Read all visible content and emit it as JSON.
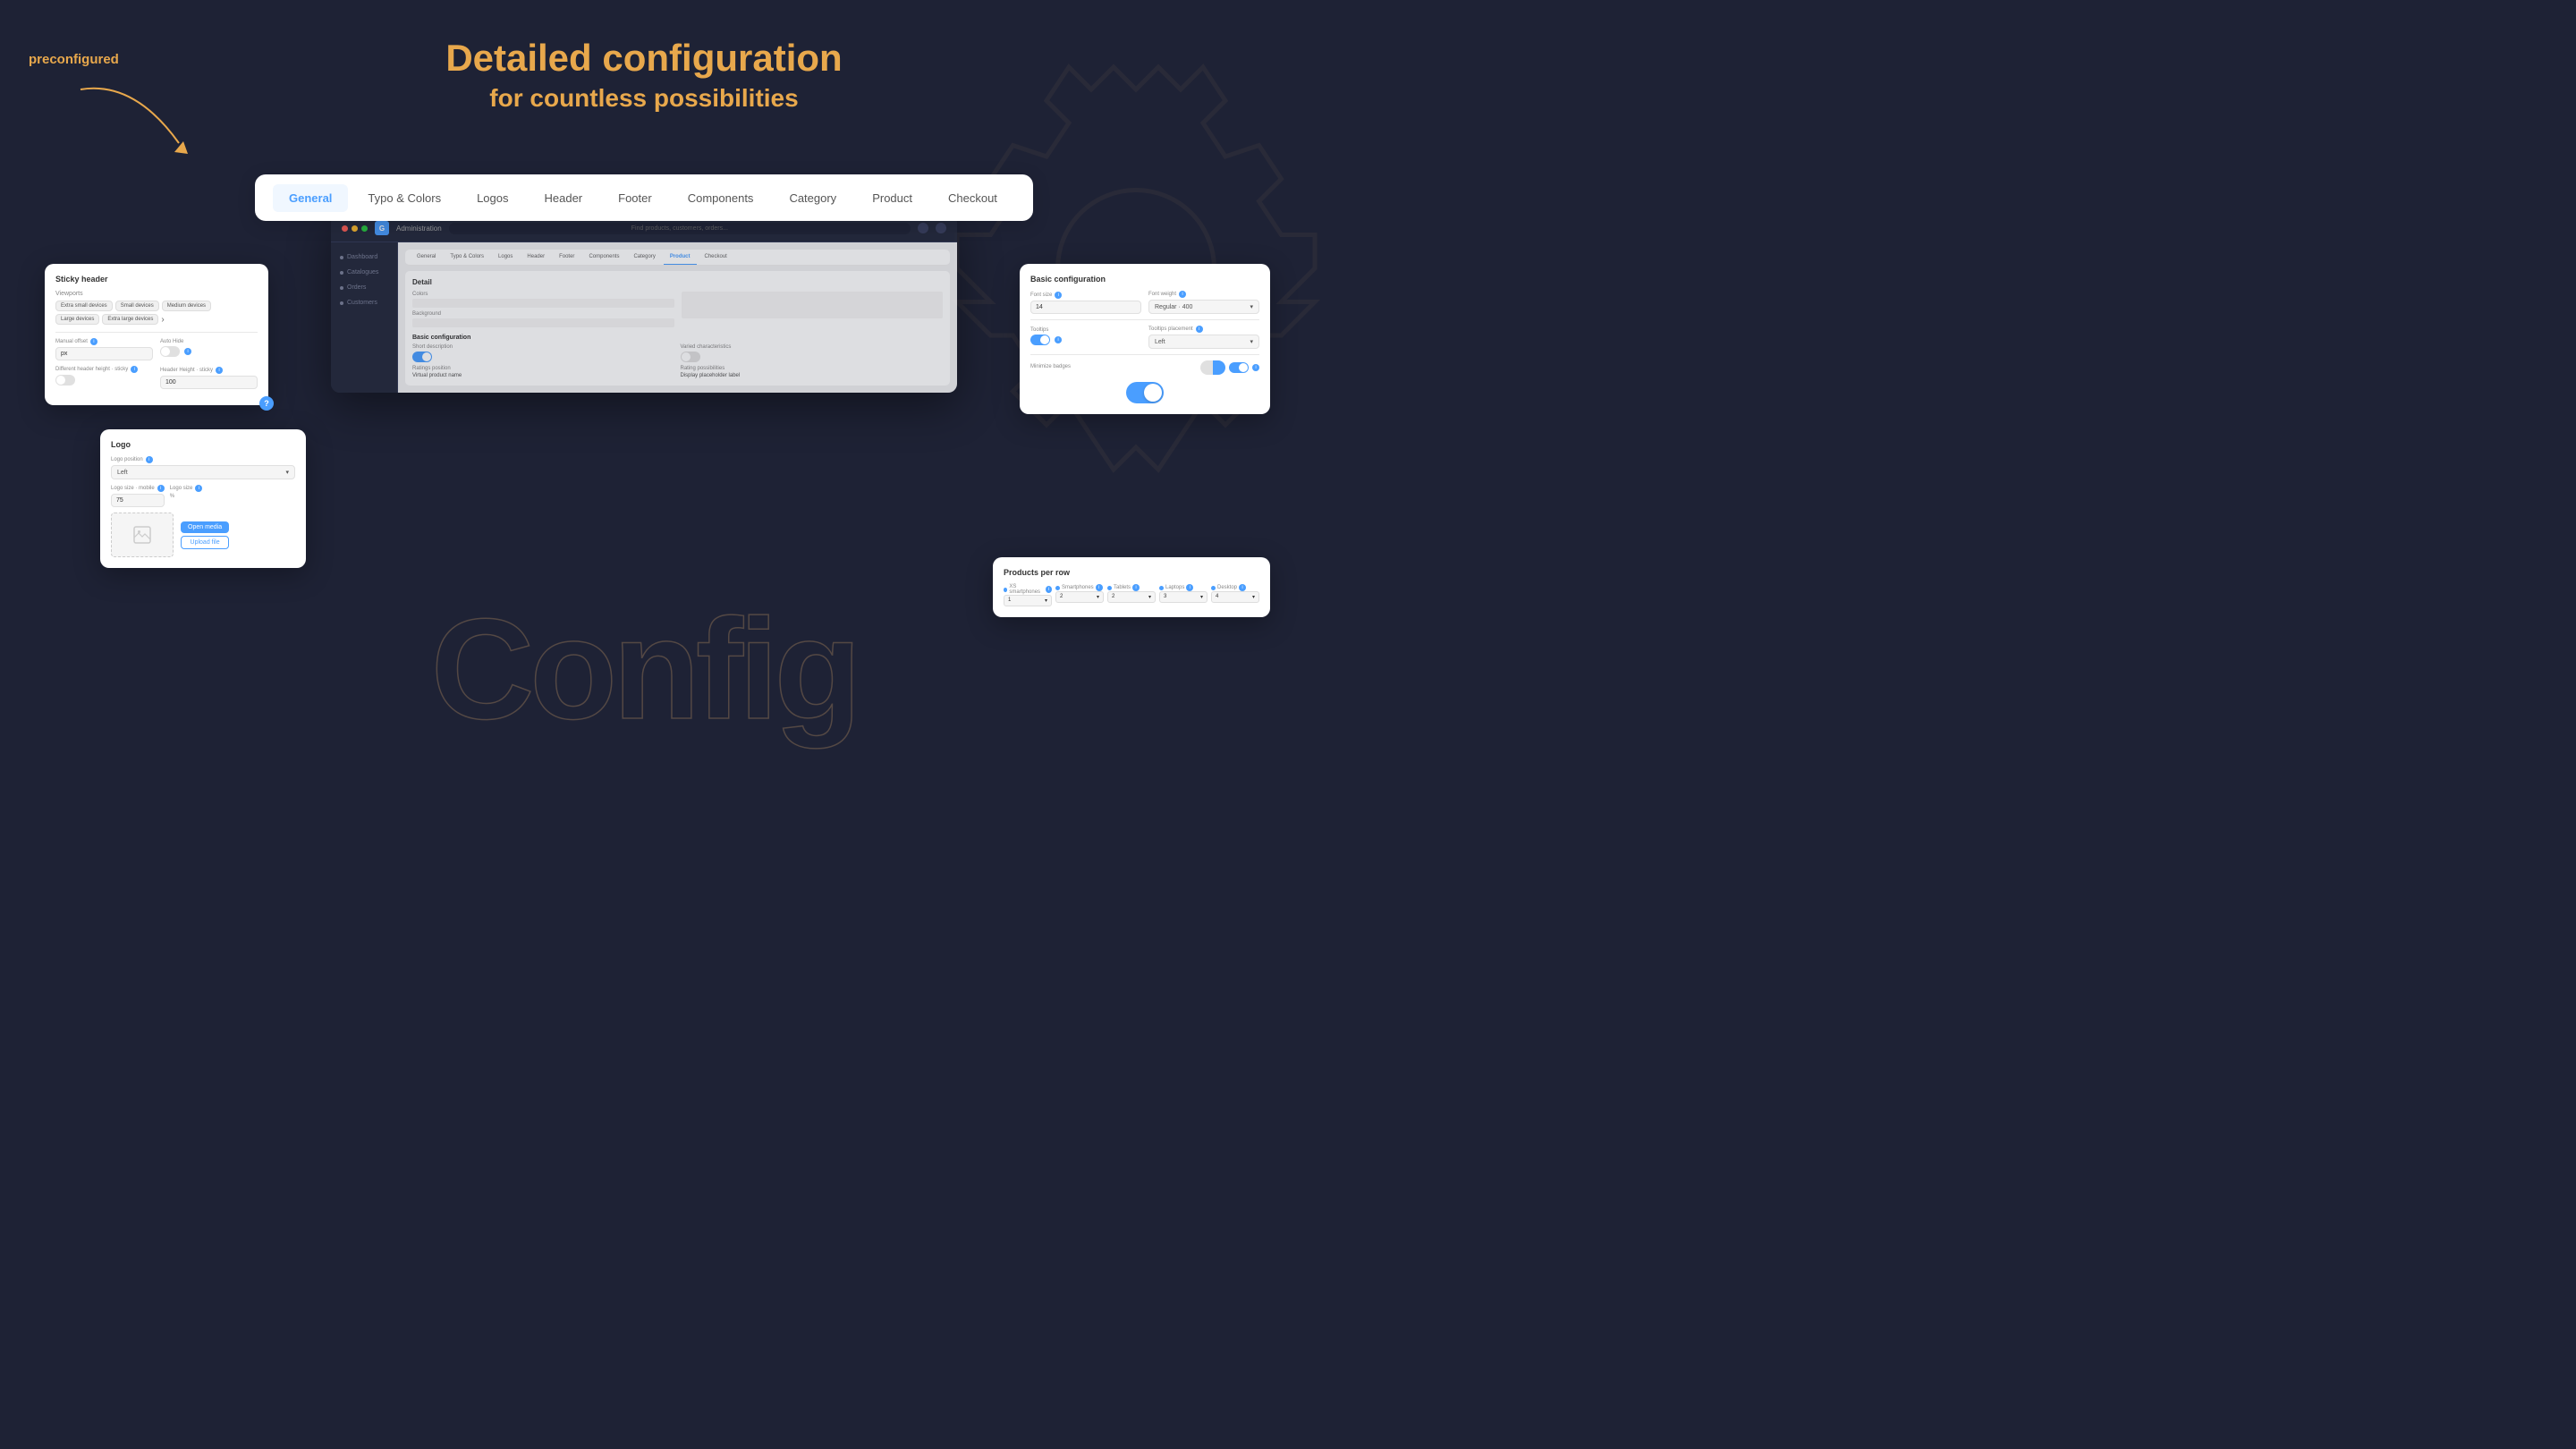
{
  "hero": {
    "title": "Detailed configuration",
    "subtitle": "for countless possibilities",
    "preconfigured": "preconfigured",
    "watermark": "Config"
  },
  "main_tab_bar": {
    "tabs": [
      {
        "label": "General",
        "active": true
      },
      {
        "label": "Typo & Colors",
        "active": false
      },
      {
        "label": "Logos",
        "active": false
      },
      {
        "label": "Header",
        "active": false
      },
      {
        "label": "Footer",
        "active": false
      },
      {
        "label": "Components",
        "active": false
      },
      {
        "label": "Category",
        "active": false
      },
      {
        "label": "Product",
        "active": false
      },
      {
        "label": "Checkout",
        "active": false
      }
    ]
  },
  "admin_panel": {
    "title": "Administration",
    "search_placeholder": "Find products, customers, orders...",
    "sidebar_items": [
      "Dashboard",
      "Catalogues",
      "Orders",
      "Customers"
    ]
  },
  "card_sticky_header": {
    "title": "Sticky header",
    "viewports_label": "Viewports",
    "chips": [
      "Extra small devices",
      "Small devices",
      "Medium devices",
      "Large devices",
      "Extra large devices"
    ],
    "manual_offset": "Manual offset",
    "auto_hide": "Auto Hide",
    "different_header_height": "Different header height · sticky",
    "header_height": "Header Height · sticky",
    "header_height_value": "100",
    "help": "?"
  },
  "card_logo": {
    "title": "Logo",
    "logo_position_label": "Logo position",
    "logo_position_value": "Left",
    "logo_size_label_mobile": "Logo size · mobile",
    "logo_size_label": "Logo size",
    "logo_size_value": "75",
    "btn_open_media": "Open media",
    "btn_upload_file": "Upload file"
  },
  "card_basic_config": {
    "title": "Basic configuration",
    "font_size_label": "Font size",
    "font_size_value": "14",
    "font_weight_label": "Font weight",
    "font_weight_value": "Regular · 400",
    "tooltips_label": "Tooltips",
    "tooltips_placement_label": "Tooltips placement",
    "tooltips_placement_value": "Left",
    "minimize_badges_label": "Minimize badges"
  },
  "card_products_per_row": {
    "title": "Products per row",
    "columns": [
      {
        "label": "XS smartphones",
        "value": "1"
      },
      {
        "label": "Smartphones",
        "value": "2"
      },
      {
        "label": "Tablets",
        "value": "2"
      },
      {
        "label": "Laptops",
        "value": "3"
      },
      {
        "label": "Desktop",
        "value": "4"
      }
    ]
  },
  "inner_panel_tabs": [
    "General",
    "Typo & Colors",
    "Logos",
    "Header",
    "Footer",
    "Components",
    "Category",
    "Product",
    "Checkout"
  ],
  "colors": {
    "blue": "#4a9eff",
    "orange": "#e8a84c",
    "bg": "#1e2235",
    "white": "#ffffff"
  }
}
